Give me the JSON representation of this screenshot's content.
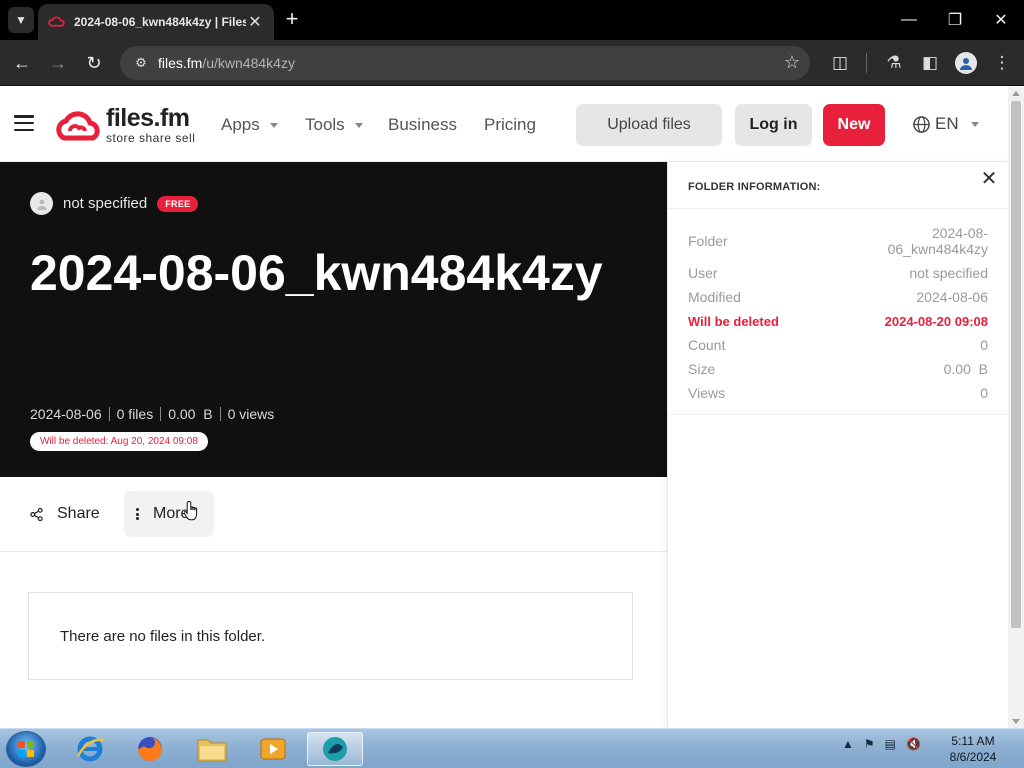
{
  "browser": {
    "tab_title": "2024-08-06_kwn484k4zy | Files.fm",
    "url_host": "files.fm",
    "url_path": "/u/kwn484k4zy"
  },
  "header": {
    "brand": "files.fm",
    "tagline": "store share sell",
    "nav": [
      "Apps",
      "Tools",
      "Business",
      "Pricing"
    ],
    "upload_label": "Upload files",
    "login_label": "Log in",
    "new_label": "New",
    "language": "EN"
  },
  "hero": {
    "owner": "not specified",
    "badge": "FREE",
    "title": "2024-08-06_kwn484k4zy",
    "stats": {
      "date": "2024-08-06",
      "files": "0 files",
      "size": "0.00  B",
      "views": "0 views"
    },
    "delete_notice": "Will be deleted: Aug 20, 2024 09:08"
  },
  "actions": {
    "share_label": "Share",
    "more_label": "More"
  },
  "empty_message": "There are no files in this folder.",
  "info_panel": {
    "title": "FOLDER INFORMATION:",
    "rows": [
      {
        "key": "Folder",
        "value": "2024-08-06_kwn484k4zy"
      },
      {
        "key": "User",
        "value": "not specified"
      },
      {
        "key": "Modified",
        "value": "2024-08-06"
      },
      {
        "key": "Will be deleted",
        "value": "2024-08-20 09:08"
      },
      {
        "key": "Count",
        "value": "0"
      },
      {
        "key": "Size",
        "value": "0.00  B"
      },
      {
        "key": "Views",
        "value": "0"
      }
    ]
  },
  "taskbar": {
    "time": "5:11 AM",
    "date": "8/6/2024"
  },
  "colors": {
    "accent": "#e8203c",
    "hero_bg": "#101010"
  }
}
